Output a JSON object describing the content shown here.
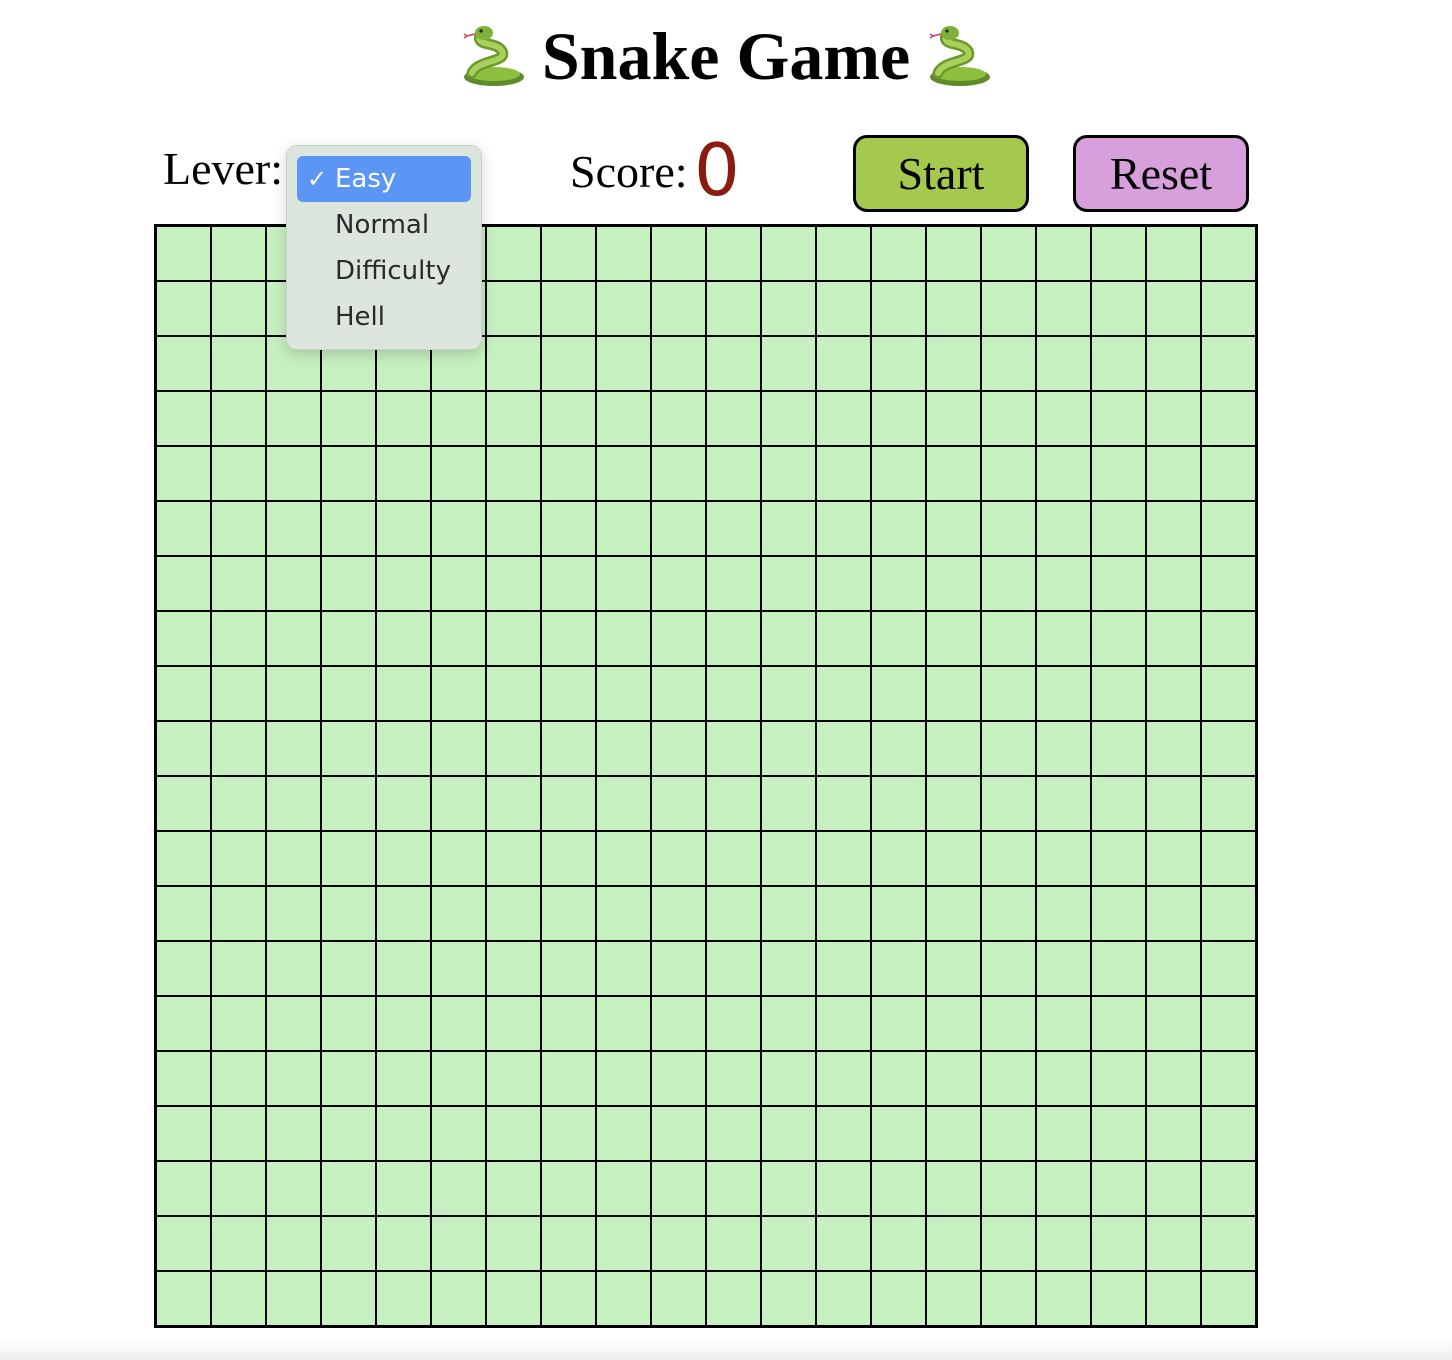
{
  "header": {
    "title": "Snake Game",
    "left_icon": "snake-icon",
    "right_icon": "snake-icon"
  },
  "controls": {
    "lever_label": "Lever:",
    "level_select": {
      "selected": "Easy",
      "options": [
        "Easy",
        "Normal",
        "Difficulty",
        "Hell"
      ],
      "check_icon": "check-icon",
      "highlight_color": "#5b96f5"
    },
    "score_label": "Score:",
    "score_value": "0",
    "score_color": "#8b1a10",
    "start_label": "Start",
    "start_color": "#a5c94d",
    "reset_label": "Reset",
    "reset_color": "#d7a0dd"
  },
  "board": {
    "rows": 20,
    "cols": 20,
    "cell_color": "#c6f0c0",
    "line_color": "#000000"
  }
}
